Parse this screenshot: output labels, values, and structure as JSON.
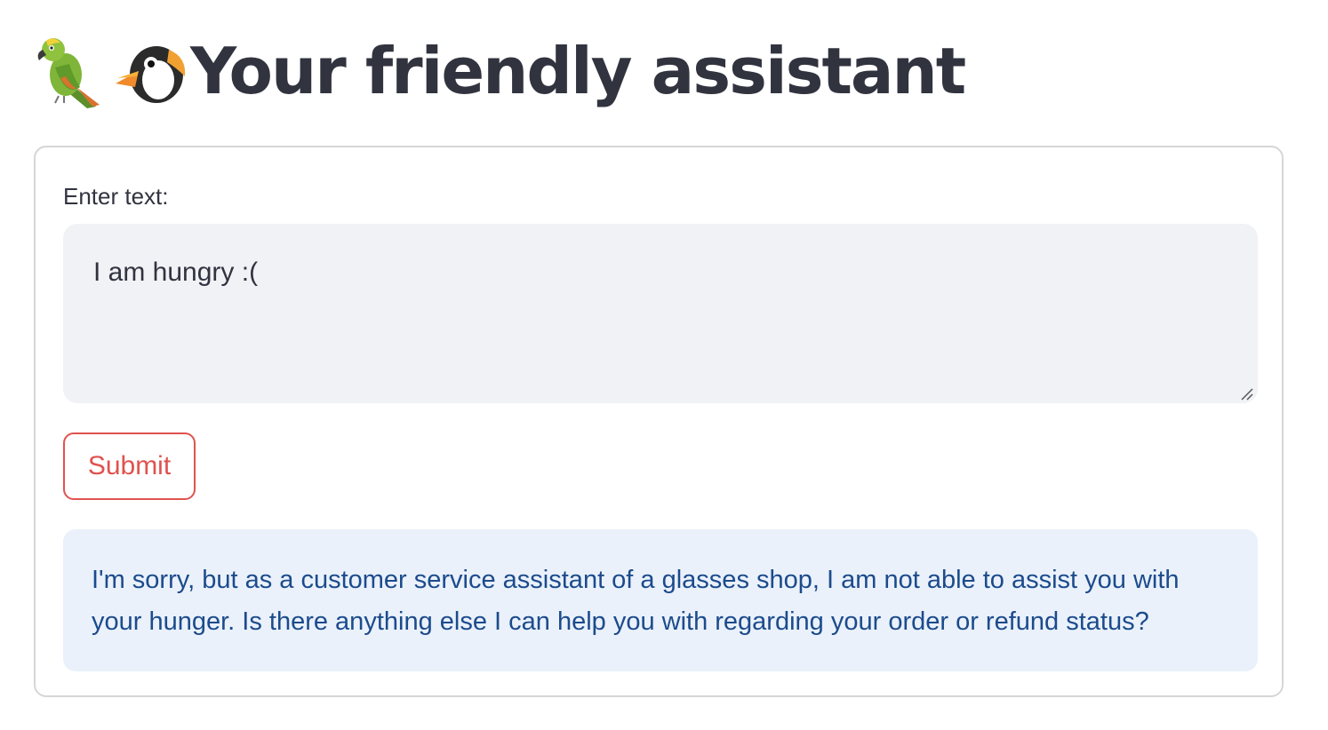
{
  "header": {
    "icons": [
      "parrot-emoji",
      "penguin-emoji"
    ],
    "title": "Your friendly assistant"
  },
  "form": {
    "label": "Enter text:",
    "input_value": "I am hungry :(",
    "submit_label": "Submit",
    "response": "I'm sorry, but as a customer service assistant of a glasses shop, I am not able to assist you with your hunger. Is there anything else I can help you with regarding your order or refund status?"
  },
  "colors": {
    "title": "#31333f",
    "input_bg": "#f0f2f6",
    "button_accent": "#e0524e",
    "response_bg": "#eaf1fb",
    "response_text": "#1c4b8c",
    "card_border": "#d6d6d9"
  }
}
